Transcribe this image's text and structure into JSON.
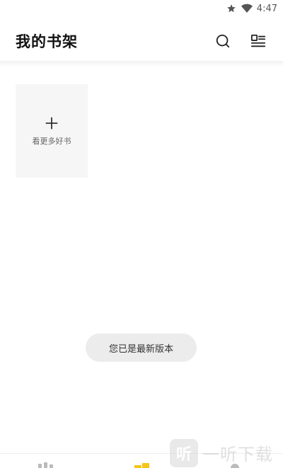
{
  "status_bar": {
    "time": "4:47",
    "icons": [
      "star-icon",
      "wifi-icon"
    ]
  },
  "header": {
    "title": "我的书架",
    "actions": [
      "search-icon",
      "list-manage-icon"
    ]
  },
  "shelf": {
    "add_card_label": "看更多好书"
  },
  "toast": {
    "text": "您已是最新版本"
  },
  "bottom_nav": {
    "items": [
      "store-icon",
      "shelf-icon",
      "profile-icon"
    ],
    "active_color": "#f5c518"
  },
  "watermark": {
    "logo_char": "听",
    "text": "一听下载"
  }
}
